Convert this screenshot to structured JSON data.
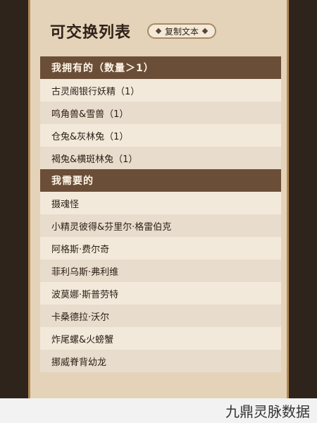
{
  "header": {
    "title": "可交换列表",
    "copy_button": "复制文本"
  },
  "sections": {
    "have": {
      "title": "我拥有的（数量＞1）",
      "items": [
        "古灵阁银行妖精（1）",
        "鸣角兽&雪兽（1）",
        "仓兔&灰林兔（1）",
        "褐兔&横斑林兔（1）"
      ]
    },
    "need": {
      "title": "我需要的",
      "items": [
        "摄魂怪",
        "小精灵彼得&芬里尔·格雷伯克",
        "阿格斯·费尔奇",
        "菲利乌斯·弗利维",
        "波莫娜·斯普劳特",
        "卡桑德拉·沃尔",
        "炸尾螺&火螃蟹",
        "挪威脊背幼龙"
      ]
    }
  },
  "watermark": "九鼎灵脉数据"
}
